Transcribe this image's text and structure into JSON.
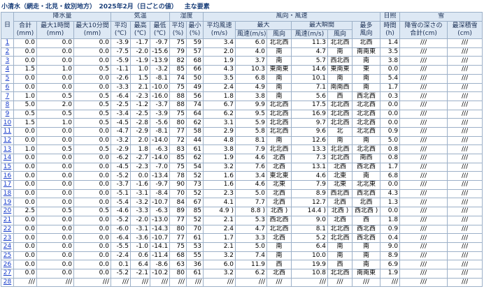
{
  "title": "小清水（網走・北見・紋別地方）　2025年2月（日ごとの値）",
  "subtitle": "主な要素",
  "groups": [
    "日",
    "降水量",
    "気温",
    "湿度",
    "風向・風速",
    "日照",
    "雪"
  ],
  "sub1": {
    "rain_total": "合計",
    "rain_1h": "最大1時間",
    "rain_10m": "最大10分間",
    "temp_avg": "平均",
    "temp_max": "最高",
    "temp_min": "最低",
    "hum_avg": "平均",
    "hum_min": "最小",
    "wind_avg": "平均風速",
    "wind_max": "最大",
    "wind_gust": "最大瞬間",
    "wind_mode": "最多",
    "sun": "時間",
    "snow_fall": "降雪の深さの",
    "snow_depth": "最深積雪"
  },
  "sub2": {
    "mm": "(mm)",
    "c": "(℃)",
    "pct": "(%)",
    "ms": "(m/s)",
    "speed_ms": "風速(m/s)",
    "dir": "風向",
    "mode_dir": "風向",
    "h": "(h)",
    "cm_sum": "合計(cm)",
    "cm": "(cm)"
  },
  "rows": [
    [
      "1",
      "0.0",
      "0.0",
      "0.0",
      "-3.9",
      "-1.7",
      "-9.7",
      "75",
      "59",
      "3.4",
      "6.0",
      "北北西",
      "11.3",
      "北北西",
      "北西",
      "1.4",
      "///",
      "///"
    ],
    [
      "2",
      "0.0",
      "0.0",
      "0.0",
      "-7.5",
      "-2.0",
      "-15.6",
      "79",
      "57",
      "2.0",
      "4.0",
      "南",
      "4.7",
      "南",
      "南南東",
      "3.5",
      "///",
      "///"
    ],
    [
      "3",
      "0.0",
      "0.0",
      "0.0",
      "-5.9",
      "-1.9",
      "-13.9",
      "82",
      "68",
      "1.9",
      "3.7",
      "南",
      "5.7",
      "西北西",
      "南",
      "3.8",
      "///",
      "///"
    ],
    [
      "4",
      "1.5",
      "1.0",
      "0.5",
      "-1.1",
      "1.0",
      "-3.2",
      "85",
      "66",
      "4.3",
      "10.3",
      "東南東",
      "14.6",
      "東南東",
      "東",
      "0.0",
      "///",
      "///"
    ],
    [
      "5",
      "0.0",
      "0.0",
      "0.0",
      "-2.6",
      "1.5",
      "-8.1",
      "74",
      "50",
      "3.5",
      "6.8",
      "南",
      "10.1",
      "南",
      "南",
      "5.4",
      "///",
      "///"
    ],
    [
      "6",
      "0.0",
      "0.0",
      "0.0",
      "-3.3",
      "2.1",
      "-10.0",
      "75",
      "49",
      "2.4",
      "4.9",
      "南",
      "7.1",
      "南南西",
      "南",
      "1.7",
      "///",
      "///"
    ],
    [
      "7",
      "1.0",
      "0.5",
      "0.5",
      "-6.4",
      "-2.3",
      "-16.0",
      "88",
      "56",
      "1.8",
      "3.8",
      "南",
      "5.6",
      "西",
      "西北西",
      "0.3",
      "///",
      "///"
    ],
    [
      "8",
      "5.0",
      "2.0",
      "0.5",
      "-2.5",
      "-1.2",
      "-3.7",
      "88",
      "74",
      "6.7",
      "9.9",
      "北北西",
      "17.5",
      "北北西",
      "北北西",
      "0.0",
      "///",
      "///"
    ],
    [
      "9",
      "0.5",
      "0.5",
      "0.5",
      "-3.4",
      "-2.5",
      "-3.9",
      "75",
      "64",
      "6.2",
      "9.5",
      "北北西",
      "16.9",
      "北北西",
      "北北西",
      "0.0",
      "///",
      "///"
    ],
    [
      "10",
      "1.5",
      "1.0",
      "0.5",
      "-4.5",
      "-2.8",
      "-5.6",
      "80",
      "62",
      "3.1",
      "5.9",
      "北北西",
      "9.7",
      "北北西",
      "北北西",
      "0.0",
      "///",
      "///"
    ],
    [
      "11",
      "0.0",
      "0.0",
      "0.0",
      "-4.7",
      "-2.9",
      "-8.1",
      "77",
      "58",
      "2.9",
      "5.8",
      "北北西",
      "9.6",
      "北",
      "北北西",
      "0.9",
      "///",
      "///"
    ],
    [
      "12",
      "0.0",
      "0.0",
      "0.0",
      "-3.2",
      "2.0",
      "-14.0",
      "72",
      "44",
      "4.8",
      "8.1",
      "南",
      "12.6",
      "南",
      "南",
      "5.0",
      "///",
      "///"
    ],
    [
      "13",
      "1.0",
      "0.5",
      "0.5",
      "-2.9",
      "1.8",
      "-6.3",
      "83",
      "61",
      "3.8",
      "7.9",
      "北北西",
      "13.3",
      "北北西",
      "北北西",
      "0.8",
      "///",
      "///"
    ],
    [
      "14",
      "0.0",
      "0.0",
      "0.0",
      "-6.2",
      "-2.7",
      "-14.0",
      "85",
      "62",
      "1.9",
      "4.6",
      "北西",
      "7.3",
      "北北西",
      "南西",
      "0.8",
      "///",
      "///"
    ],
    [
      "15",
      "0.0",
      "0.0",
      "0.0",
      "-4.5",
      "-2.3",
      "-7.0",
      "75",
      "54",
      "3.2",
      "7.6",
      "北西",
      "13.1",
      "北西",
      "西北西",
      "1.7",
      "///",
      "///"
    ],
    [
      "16",
      "0.0",
      "0.0",
      "0.0",
      "-5.2",
      "0.0",
      "-13.4",
      "78",
      "52",
      "1.6",
      "3.4",
      "東北東",
      "4.6",
      "北東",
      "南",
      "6.8",
      "///",
      "///"
    ],
    [
      "17",
      "0.0",
      "0.0",
      "0.0",
      "-3.7",
      "-1.6",
      "-9.7",
      "90",
      "73",
      "1.6",
      "4.6",
      "北東",
      "7.9",
      "北東",
      "北北東",
      "0.0",
      "///",
      "///"
    ],
    [
      "18",
      "0.0",
      "0.0",
      "0.0",
      "-5.1",
      "-3.1",
      "-8.4",
      "70",
      "52",
      "2.3",
      "5.0",
      "北西",
      "8.9",
      "西北西",
      "西北西",
      "4.3",
      "///",
      "///"
    ],
    [
      "19",
      "0.0",
      "0.0",
      "0.0",
      "-5.4",
      "-3.2",
      "-10.7",
      "84",
      "67",
      "4.1",
      "7.7",
      "北西",
      "12.7",
      "北西",
      "北西",
      "1.3",
      "///",
      "///"
    ],
    [
      "20",
      "2.5",
      "0.5",
      "0.5",
      "-4.6",
      "-3.3",
      "-6.3",
      "89",
      "85",
      "4.9 )",
      "8.8 )",
      "北西 )",
      "14.4 )",
      "北西 )",
      "西北西 )",
      "0.0",
      "///",
      "///"
    ],
    [
      "21",
      "0.0",
      "0.0",
      "0.0",
      "-5.2",
      "-2.0",
      "-13.0",
      "77",
      "52",
      "2.1",
      "5.3",
      "西北西",
      "9.0",
      "北西",
      "西",
      "1.8",
      "///",
      "///"
    ],
    [
      "22",
      "0.0",
      "0.0",
      "0.0",
      "-6.0",
      "-3.1",
      "-14.3",
      "80",
      "70",
      "2.4",
      "4.7",
      "北北西",
      "8.1",
      "北北西",
      "西北西",
      "0.9",
      "///",
      "///"
    ],
    [
      "23",
      "0.0",
      "0.0",
      "0.0",
      "-6.4",
      "-3.6",
      "-10.7",
      "77",
      "61",
      "1.7",
      "3.3",
      "北西",
      "5.2",
      "北北西",
      "西北西",
      "0.4",
      "///",
      "///"
    ],
    [
      "24",
      "0.0",
      "0.0",
      "0.0",
      "-5.5",
      "-1.0",
      "-14.1",
      "75",
      "53",
      "2.1",
      "5.0",
      "南",
      "6.4",
      "南",
      "南",
      "9.0",
      "///",
      "///"
    ],
    [
      "25",
      "0.0",
      "0.0",
      "0.0",
      "-2.4",
      "0.6",
      "-11.4",
      "68",
      "55",
      "3.2",
      "7.4",
      "南",
      "10.0",
      "南",
      "南",
      "8.9",
      "///",
      "///"
    ],
    [
      "26",
      "0.0",
      "0.0",
      "0.0",
      "0.1",
      "6.4",
      "-8.6",
      "63",
      "36",
      "6.0",
      "11.9",
      "西",
      "19.9",
      "西",
      "南",
      "6.9",
      "///",
      "///"
    ],
    [
      "27",
      "0.0",
      "0.0",
      "0.0",
      "-5.2",
      "-2.1",
      "-10.2",
      "80",
      "61",
      "3.2",
      "6.2",
      "北西",
      "10.8",
      "北北西",
      "南南東",
      "1.9",
      "///",
      "///"
    ],
    [
      "28",
      "///",
      "///",
      "///",
      "///",
      "///",
      "///",
      "///",
      "///",
      "///",
      "///",
      "///",
      "///",
      "///",
      "///",
      "///",
      "///",
      "///"
    ]
  ]
}
